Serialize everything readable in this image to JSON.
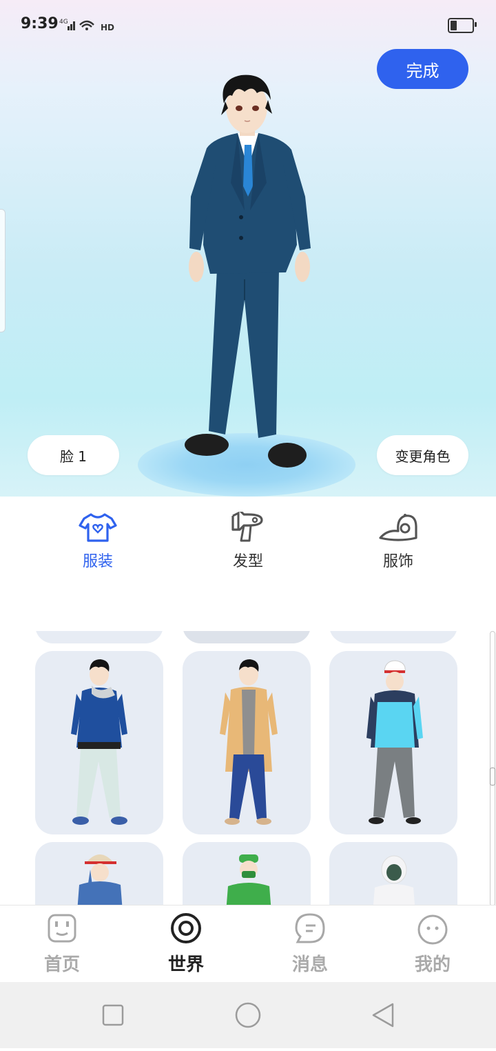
{
  "status_bar": {
    "time": "9:39",
    "network": "4G",
    "hd": "HD"
  },
  "stage": {
    "done_label": "完成",
    "face_label": "脸 1",
    "change_label": "变更角色"
  },
  "categories": [
    {
      "label": "服装",
      "icon": "tshirt-icon",
      "active": true
    },
    {
      "label": "发型",
      "icon": "hairdryer-icon",
      "active": false
    },
    {
      "label": "服饰",
      "icon": "cap-icon",
      "active": false
    }
  ],
  "outfits": [
    {
      "name": "blue-jacket-outfit",
      "colors": {
        "top": "#1f4f9e",
        "bottom": "#d8e8e4",
        "accent": "#cfd3d6"
      }
    },
    {
      "name": "tan-coat-outfit",
      "colors": {
        "top": "#e8b877",
        "bottom": "#2a4a98",
        "accent": "#8f8f8f"
      }
    },
    {
      "name": "cyan-vest-outfit",
      "colors": {
        "top": "#5ad5f2",
        "bottom": "#7a7f82",
        "accent": "#2c3e5f"
      }
    },
    {
      "name": "bucket-hat-outfit",
      "colors": {
        "top": "#4472b8",
        "bottom": "#4472b8",
        "accent": "#e7d7b9"
      }
    },
    {
      "name": "green-scrubs-outfit",
      "colors": {
        "top": "#3fae4b",
        "bottom": "#3fae4b",
        "accent": "#2f8f3b"
      }
    },
    {
      "name": "white-hoodie-outfit",
      "colors": {
        "top": "#f4f4f6",
        "bottom": "#f4f4f6",
        "accent": "#3b5b4b"
      }
    }
  ],
  "nav": [
    {
      "label": "首页",
      "icon": "home-icon",
      "active": false
    },
    {
      "label": "世界",
      "icon": "world-icon",
      "active": true
    },
    {
      "label": "消息",
      "icon": "message-icon",
      "active": false
    },
    {
      "label": "我的",
      "icon": "profile-icon",
      "active": false
    }
  ],
  "colors": {
    "accent": "#2f62ee",
    "suit": "#1f4d73",
    "tie": "#2a86d6"
  }
}
